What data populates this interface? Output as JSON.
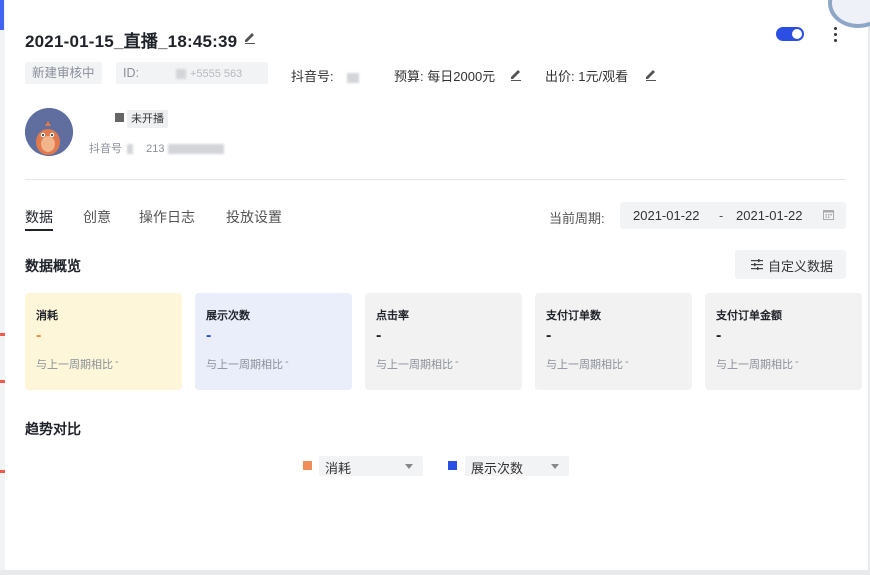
{
  "header": {
    "title": "2021-01-15_直播_18:45:39",
    "status_chip": "新建审核中",
    "id_label": "ID:",
    "id_value": "+5555 563",
    "douyin_label": "抖音号:",
    "budget_label": "预算:",
    "budget_value": "每日2000元",
    "bid_label": "出价:",
    "bid_value": "1元/观看",
    "toggle_on": true
  },
  "account": {
    "live_status": "未开播",
    "douyin_id_label": "抖音号",
    "douyin_id_value": "213"
  },
  "tabs": [
    {
      "label": "数据",
      "active": true
    },
    {
      "label": "创意",
      "active": false
    },
    {
      "label": "操作日志",
      "active": false
    },
    {
      "label": "投放设置",
      "active": false
    }
  ],
  "period": {
    "label": "当前周期:",
    "start": "2021-01-22",
    "separator": "-",
    "end": "2021-01-22"
  },
  "overview": {
    "title": "数据概览",
    "custom_button": "自定义数据",
    "cards": [
      {
        "name": "消耗",
        "value": "-",
        "compare_label": "与上一周期相比",
        "compare_value": "-",
        "bg": "#fdf6d8",
        "value_color": "#f08c3c"
      },
      {
        "name": "展示次数",
        "value": "-",
        "compare_label": "与上一周期相比",
        "compare_value": "-",
        "bg": "#eaedfa",
        "value_color": "#2b4fe3"
      },
      {
        "name": "点击率",
        "value": "-",
        "compare_label": "与上一周期相比",
        "compare_value": "-",
        "bg": "#f2f2f2",
        "value_color": "#1f2329"
      },
      {
        "name": "支付订单数",
        "value": "-",
        "compare_label": "与上一周期相比",
        "compare_value": "-",
        "bg": "#f2f2f2",
        "value_color": "#1f2329"
      },
      {
        "name": "支付订单金额",
        "value": "-",
        "compare_label": "与上一周期相比",
        "compare_value": "-",
        "bg": "#f2f2f2",
        "value_color": "#1f2329"
      }
    ]
  },
  "trend": {
    "title": "趋势对比",
    "metrics": [
      {
        "label": "消耗",
        "color": "#f08c5a"
      },
      {
        "label": "展示次数",
        "color": "#2b4fe3"
      }
    ]
  },
  "colors": {
    "accent": "#2b4fe3",
    "spend": "#f08c5a"
  }
}
